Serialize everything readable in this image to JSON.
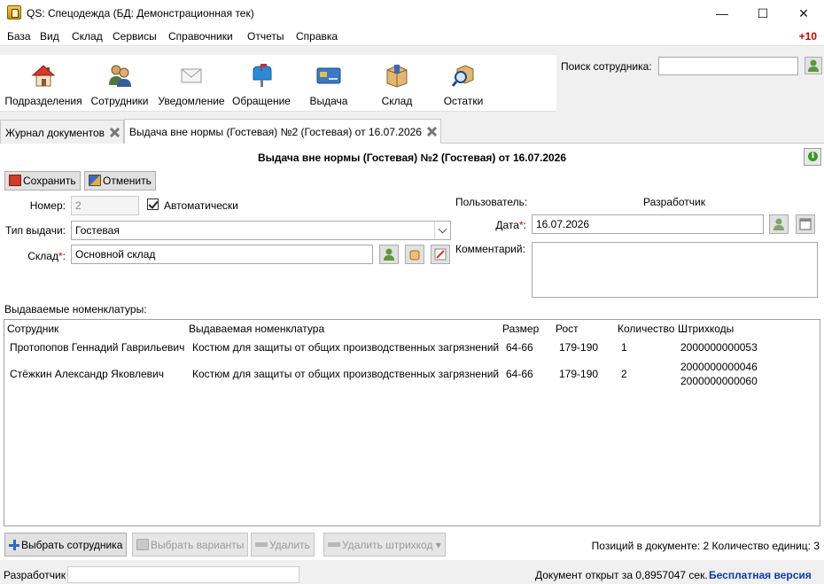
{
  "window": {
    "title": "QS: Спецодежда (БД: Демонстрационная тек)",
    "controls": {
      "minimize": "—",
      "maximize": "☐",
      "close": "✕"
    }
  },
  "menu": {
    "items": [
      "База",
      "Вид",
      "Склад",
      "Сервисы",
      "Справочники",
      "Отчеты",
      "Справка"
    ],
    "notification_count": "+10"
  },
  "toolbar": {
    "buttons": [
      {
        "label": "Подразделения",
        "icon": "house-icon"
      },
      {
        "label": "Сотрудники",
        "icon": "people-icon"
      },
      {
        "label": "Уведомление",
        "icon": "envelope-icon"
      },
      {
        "label": "Обращение",
        "icon": "mailbox-icon"
      },
      {
        "label": "Выдача",
        "icon": "card-icon"
      },
      {
        "label": "Склад",
        "icon": "box-icon"
      },
      {
        "label": "Остатки",
        "icon": "magnifier-box-icon"
      }
    ],
    "search_label": "Поиск сотрудника:",
    "search_value": ""
  },
  "tabs": [
    {
      "label": "Журнал документов"
    },
    {
      "label": "Выдача вне нормы (Гостевая) №2 (Гостевая) от 16.07.2026"
    }
  ],
  "document": {
    "title": "Выдача вне нормы (Гостевая) №2 (Гостевая) от 16.07.2026",
    "save_label": "Сохранить",
    "cancel_label": "Отменить",
    "number_label": "Номер:",
    "number_value": "2",
    "auto_label": "Автоматически",
    "issue_type_label": "Тип выдачи:",
    "issue_type_value": "Гостевая",
    "warehouse_label": "Склад",
    "warehouse_value": "Основной склад",
    "user_label": "Пользователь:",
    "user_value": "Разработчик",
    "date_label": "Дата",
    "date_value": "16.07.2026",
    "comment_label": "Комментарий:",
    "comment_value": "",
    "items_label": "Выдаваемые номенклатуры:",
    "columns": [
      "Сотрудник",
      "Выдаваемая номенклатура",
      "Размер",
      "Рост",
      "Количество",
      "Штрихкоды"
    ],
    "rows": [
      {
        "employee": "Протопопов Геннадий Гаврильевич",
        "item": "Костюм для защиты от общих производственных загрязнений",
        "size": "64-66",
        "height": "179-190",
        "qty": "1",
        "barcodes": [
          "2000000000053"
        ]
      },
      {
        "employee": "Стёжкин Александр Яковлевич",
        "item": "Костюм для защиты от общих производственных загрязнений",
        "size": "64-66",
        "height": "179-190",
        "qty": "2",
        "barcodes": [
          "2000000000046",
          "2000000000060"
        ]
      }
    ],
    "buttons": {
      "select_employee": "Выбрать сотрудника",
      "select_variants": "Выбрать варианты",
      "delete": "Удалить",
      "delete_barcode": "Удалить штрихкод"
    },
    "summary": "Позиций в документе: 2  Количество единиц: 3"
  },
  "status": {
    "user": "Разработчик",
    "load_time": "Документ открыт за 0,8957047 сек.",
    "version": "Бесплатная версия"
  }
}
